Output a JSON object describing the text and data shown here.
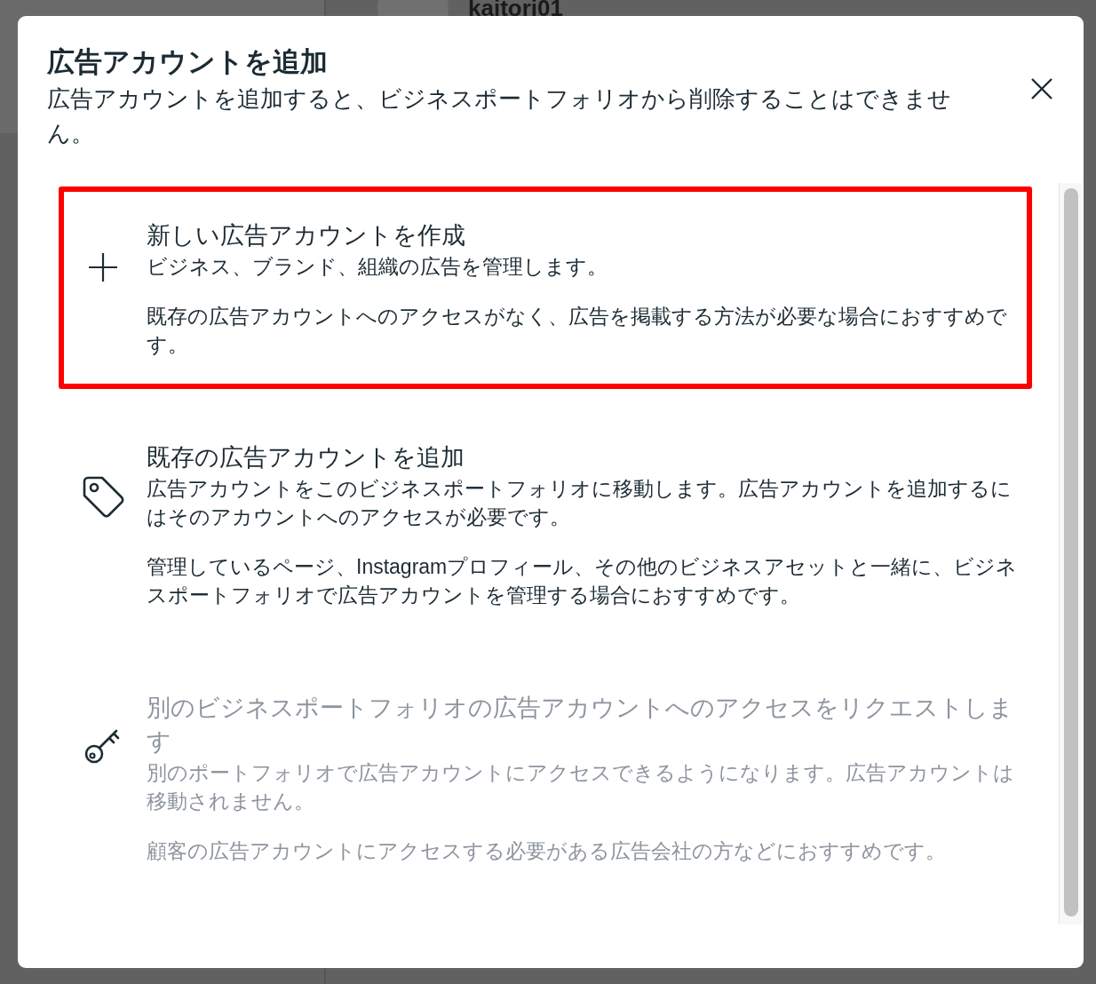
{
  "background": {
    "username": "kaitori01"
  },
  "dialog": {
    "title": "広告アカウントを追加",
    "subtitle": "広告アカウントを追加すると、ビジネスポートフォリオから削除することはできません。"
  },
  "options": [
    {
      "kind": "plus",
      "title": "新しい広告アカウントを作成",
      "description": "ビジネス、ブランド、組織の広告を管理します。",
      "note": "既存の広告アカウントへのアクセスがなく、広告を掲載する方法が必要な場合におすすめです。",
      "highlighted": true,
      "disabled": false
    },
    {
      "kind": "tag",
      "title": "既存の広告アカウントを追加",
      "description": "広告アカウントをこのビジネスポートフォリオに移動します。広告アカウントを追加するにはそのアカウントへのアクセスが必要です。",
      "note": "管理しているページ、Instagramプロフィール、その他のビジネスアセットと一緒に、ビジネスポートフォリオで広告アカウントを管理する場合におすすめです。",
      "highlighted": false,
      "disabled": false
    },
    {
      "kind": "key",
      "title": "別のビジネスポートフォリオの広告アカウントへのアクセスをリクエストします",
      "description": "別のポートフォリオで広告アカウントにアクセスできるようになります。広告アカウントは移動されません。",
      "note": "顧客の広告アカウントにアクセスする必要がある広告会社の方などにおすすめです。",
      "highlighted": false,
      "disabled": true
    }
  ]
}
